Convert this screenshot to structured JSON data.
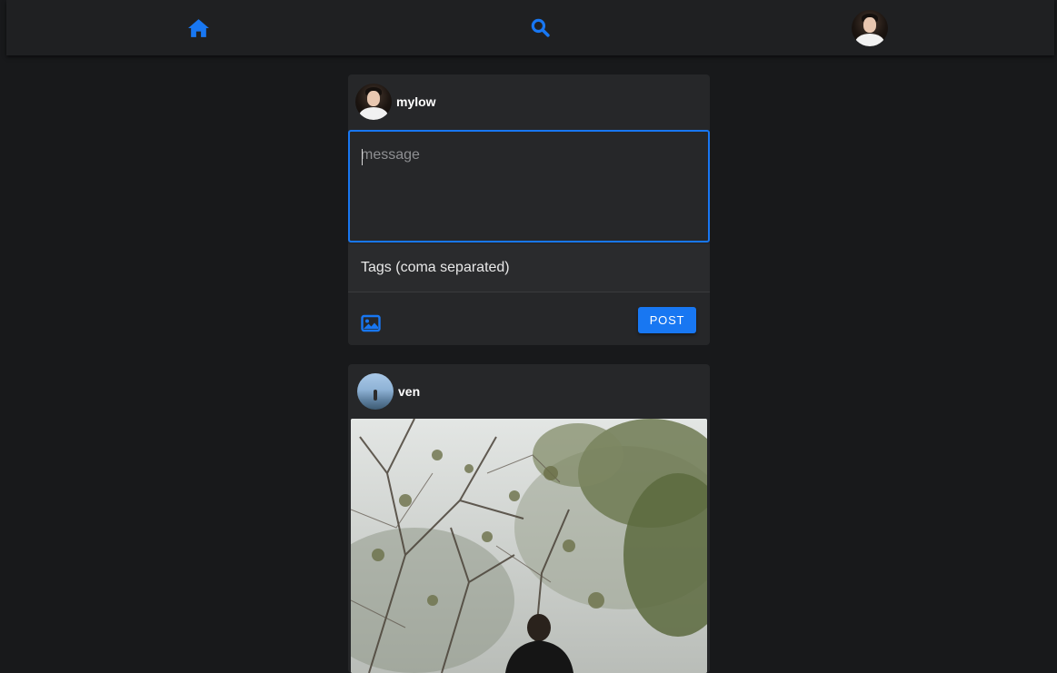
{
  "nav": {
    "home_icon": "home-icon",
    "search_icon": "search-icon",
    "profile_avatar": "user-avatar"
  },
  "composer": {
    "username": "mylow",
    "message_placeholder": "message",
    "tags_label": "Tags (coma separated)",
    "image_icon": "image-icon",
    "post_label": "POST"
  },
  "feed": [
    {
      "username": "ven",
      "image": "photo of person in misty forest"
    }
  ],
  "colors": {
    "accent": "#1877f2",
    "background": "#18191b",
    "card": "#262729",
    "nav": "#1f2022"
  }
}
